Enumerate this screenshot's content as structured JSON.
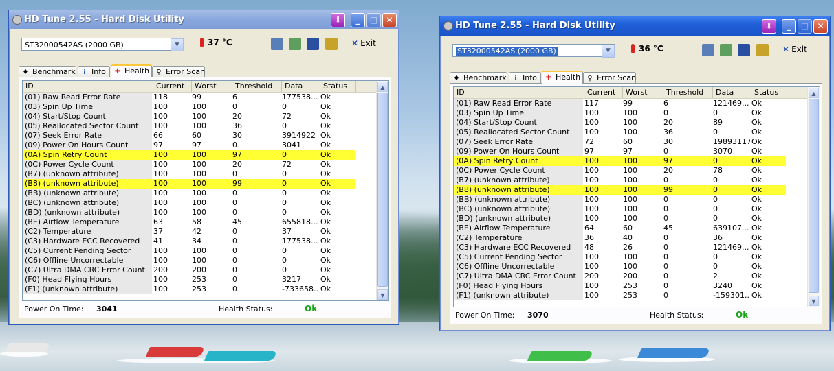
{
  "colors": {
    "highlight": "#ffff33",
    "status_ok": "#19a319",
    "active_title": "#1b54c9",
    "inactive_title": "#8aa8de"
  },
  "columns": [
    "ID",
    "Current",
    "Worst",
    "Threshold",
    "Data",
    "Status"
  ],
  "tabs": [
    {
      "label": "Benchmark",
      "icon": "gauge-icon"
    },
    {
      "label": "Info",
      "icon": "info-icon"
    },
    {
      "label": "Health",
      "icon": "health-cross-icon"
    },
    {
      "label": "Error Scan",
      "icon": "magnifier-icon"
    }
  ],
  "labels": {
    "power_on_time": "Power On Time:",
    "health_status": "Health Status:",
    "exit": "Exit"
  },
  "windows": [
    {
      "title": "HD Tune 2.55 - Hard Disk Utility",
      "drive": "ST32000542AS (2000 GB)",
      "temperature": "37 °C",
      "power_on_time": "3041",
      "health_status": "Ok",
      "rows": [
        [
          "(01) Raw Read Error Rate",
          "118",
          "99",
          "6",
          "177538...",
          "Ok"
        ],
        [
          "(03) Spin Up Time",
          "100",
          "100",
          "0",
          "0",
          "Ok"
        ],
        [
          "(04) Start/Stop Count",
          "100",
          "100",
          "20",
          "72",
          "Ok"
        ],
        [
          "(05) Reallocated Sector Count",
          "100",
          "100",
          "36",
          "0",
          "Ok"
        ],
        [
          "(07) Seek Error Rate",
          "66",
          "60",
          "30",
          "3914922",
          "Ok"
        ],
        [
          "(09) Power On Hours Count",
          "97",
          "97",
          "0",
          "3041",
          "Ok"
        ],
        [
          "(0A) Spin Retry Count",
          "100",
          "100",
          "97",
          "0",
          "Ok"
        ],
        [
          "(0C) Power Cycle Count",
          "100",
          "100",
          "20",
          "72",
          "Ok"
        ],
        [
          "(B7) (unknown attribute)",
          "100",
          "100",
          "0",
          "0",
          "Ok"
        ],
        [
          "(B8) (unknown attribute)",
          "100",
          "100",
          "99",
          "0",
          "Ok"
        ],
        [
          "(BB) (unknown attribute)",
          "100",
          "100",
          "0",
          "0",
          "Ok"
        ],
        [
          "(BC) (unknown attribute)",
          "100",
          "100",
          "0",
          "0",
          "Ok"
        ],
        [
          "(BD) (unknown attribute)",
          "100",
          "100",
          "0",
          "0",
          "Ok"
        ],
        [
          "(BE) Airflow Temperature",
          "63",
          "58",
          "45",
          "655818...",
          "Ok"
        ],
        [
          "(C2) Temperature",
          "37",
          "42",
          "0",
          "37",
          "Ok"
        ],
        [
          "(C3) Hardware ECC Recovered",
          "41",
          "34",
          "0",
          "177538...",
          "Ok"
        ],
        [
          "(C5) Current Pending Sector",
          "100",
          "100",
          "0",
          "0",
          "Ok"
        ],
        [
          "(C6) Offline Uncorrectable",
          "100",
          "100",
          "0",
          "0",
          "Ok"
        ],
        [
          "(C7) Ultra DMA CRC Error Count",
          "200",
          "200",
          "0",
          "0",
          "Ok"
        ],
        [
          "(F0) Head Flying Hours",
          "100",
          "253",
          "0",
          "3217",
          "Ok"
        ],
        [
          "(F1) (unknown attribute)",
          "100",
          "253",
          "0",
          "-733658...",
          "Ok"
        ]
      ],
      "highlighted_rows": [
        6,
        9
      ]
    },
    {
      "title": "HD Tune 2.55 - Hard Disk Utility",
      "drive": "ST32000542AS (2000 GB)",
      "temperature": "36 °C",
      "power_on_time": "3070",
      "health_status": "Ok",
      "rows": [
        [
          "(01) Raw Read Error Rate",
          "117",
          "99",
          "6",
          "121469...",
          "Ok"
        ],
        [
          "(03) Spin Up Time",
          "100",
          "100",
          "0",
          "0",
          "Ok"
        ],
        [
          "(04) Start/Stop Count",
          "100",
          "100",
          "20",
          "89",
          "Ok"
        ],
        [
          "(05) Reallocated Sector Count",
          "100",
          "100",
          "36",
          "0",
          "Ok"
        ],
        [
          "(07) Seek Error Rate",
          "72",
          "60",
          "30",
          "19893117",
          "Ok"
        ],
        [
          "(09) Power On Hours Count",
          "97",
          "97",
          "0",
          "3070",
          "Ok"
        ],
        [
          "(0A) Spin Retry Count",
          "100",
          "100",
          "97",
          "0",
          "Ok"
        ],
        [
          "(0C) Power Cycle Count",
          "100",
          "100",
          "20",
          "78",
          "Ok"
        ],
        [
          "(B7) (unknown attribute)",
          "100",
          "100",
          "0",
          "0",
          "Ok"
        ],
        [
          "(B8) (unknown attribute)",
          "100",
          "100",
          "99",
          "0",
          "Ok"
        ],
        [
          "(BB) (unknown attribute)",
          "100",
          "100",
          "0",
          "0",
          "Ok"
        ],
        [
          "(BC) (unknown attribute)",
          "100",
          "100",
          "0",
          "0",
          "Ok"
        ],
        [
          "(BD) (unknown attribute)",
          "100",
          "100",
          "0",
          "0",
          "Ok"
        ],
        [
          "(BE) Airflow Temperature",
          "64",
          "60",
          "45",
          "639107...",
          "Ok"
        ],
        [
          "(C2) Temperature",
          "36",
          "40",
          "0",
          "36",
          "Ok"
        ],
        [
          "(C3) Hardware ECC Recovered",
          "48",
          "26",
          "0",
          "121469...",
          "Ok"
        ],
        [
          "(C5) Current Pending Sector",
          "100",
          "100",
          "0",
          "0",
          "Ok"
        ],
        [
          "(C6) Offline Uncorrectable",
          "100",
          "100",
          "0",
          "0",
          "Ok"
        ],
        [
          "(C7) Ultra DMA CRC Error Count",
          "200",
          "200",
          "0",
          "2",
          "Ok"
        ],
        [
          "(F0) Head Flying Hours",
          "100",
          "253",
          "0",
          "3240",
          "Ok"
        ],
        [
          "(F1) (unknown attribute)",
          "100",
          "253",
          "0",
          "-159301...",
          "Ok"
        ]
      ],
      "highlighted_rows": [
        6,
        9
      ]
    }
  ]
}
